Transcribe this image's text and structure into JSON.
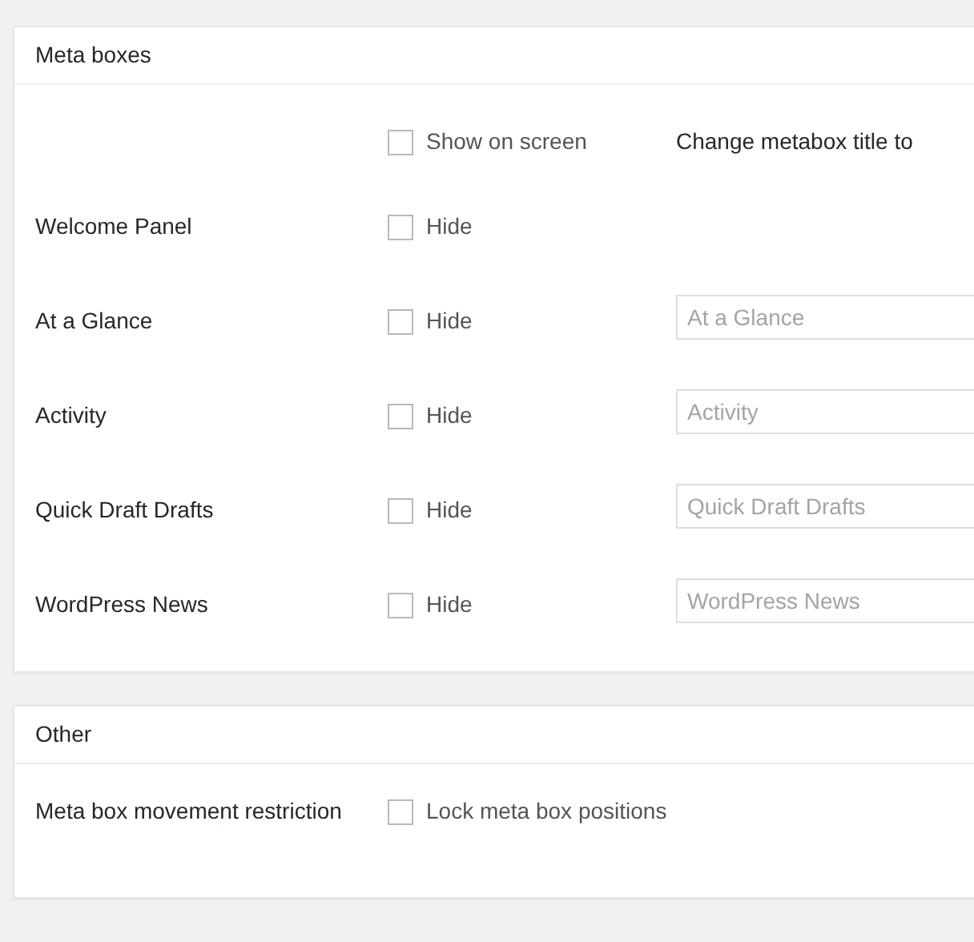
{
  "sections": [
    {
      "title": "Meta boxes",
      "rows": [
        {
          "kind": "header",
          "checkbox": {
            "label": "Show on screen",
            "checked": false
          },
          "column_heading": "Change metabox title to"
        },
        {
          "kind": "item",
          "label": "Welcome Panel",
          "checkbox": {
            "label": "Hide",
            "checked": false
          }
        },
        {
          "kind": "item",
          "label": "At a Glance",
          "checkbox": {
            "label": "Hide",
            "checked": false
          },
          "input": {
            "placeholder": "At a Glance"
          }
        },
        {
          "kind": "item",
          "label": "Activity",
          "checkbox": {
            "label": "Hide",
            "checked": false
          },
          "input": {
            "placeholder": "Activity"
          }
        },
        {
          "kind": "item",
          "label": "Quick Draft Drafts",
          "checkbox": {
            "label": "Hide",
            "checked": false
          },
          "input": {
            "placeholder": "Quick Draft Drafts"
          }
        },
        {
          "kind": "item",
          "label": "WordPress News",
          "checkbox": {
            "label": "Hide",
            "checked": false
          },
          "input": {
            "placeholder": "WordPress News"
          }
        }
      ]
    },
    {
      "title": "Other",
      "rows": [
        {
          "kind": "item",
          "label": "Meta box movement restriction",
          "checkbox": {
            "label": "Lock meta box positions",
            "checked": false
          }
        }
      ]
    }
  ]
}
